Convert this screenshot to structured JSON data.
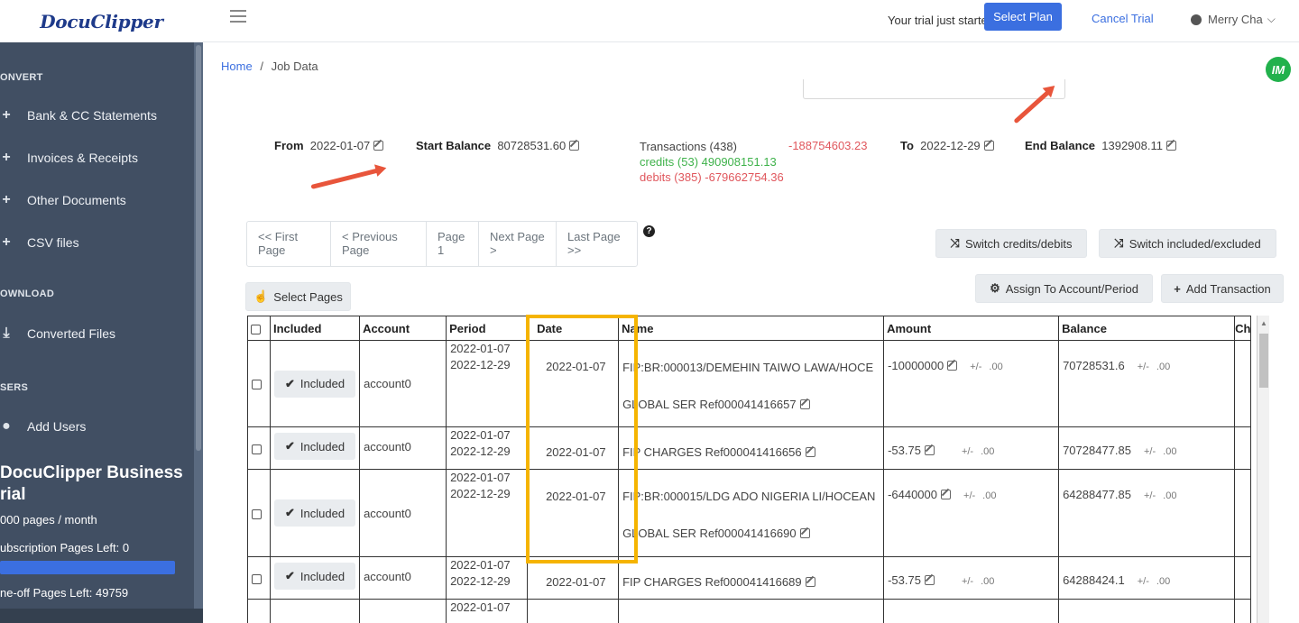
{
  "app": {
    "brand": "DocuClipper"
  },
  "sidebar": {
    "sections": [
      {
        "title": "ONVERT",
        "items": [
          "Bank & CC Statements",
          "Invoices & Receipts",
          "Other Documents",
          "CSV files"
        ]
      },
      {
        "title": "OWNLOAD",
        "items": [
          "Converted Files"
        ]
      },
      {
        "title": "SERS",
        "items": [
          "Add Users"
        ]
      }
    ],
    "plan": {
      "title_line1": "DocuClipper Business",
      "title_line2": "rial",
      "pages_per_month": "000 pages / month",
      "subscription_left": "ubscription Pages Left: 0",
      "oneoff_left": "ne-off Pages Left: 49759",
      "progress_fraction": 1.0
    }
  },
  "topbar": {
    "trial_text": "Your trial just started",
    "select_plan": "Select Plan",
    "cancel_trial": "Cancel Trial",
    "user_name": "Merry Cha"
  },
  "breadcrumb": {
    "home": "Home",
    "separator": "/",
    "current": "Job Data"
  },
  "badge": "IM",
  "summary": {
    "from_label": "From",
    "from_value": "2022-01-07",
    "start_balance_label": "Start Balance",
    "start_balance_value": "80728531.60",
    "transactions": "Transactions (438)",
    "net": "-188754603.23",
    "credits": "credits (53) 490908151.13",
    "debits": "debits (385) -679662754.36",
    "to_label": "To",
    "to_value": "2022-12-29",
    "end_balance_label": "End Balance",
    "end_balance_value": "1392908.11"
  },
  "pager": {
    "first": [
      "<< First",
      "Page"
    ],
    "previous": [
      "< Previous",
      "Page"
    ],
    "page": [
      "Page",
      "1"
    ],
    "next": [
      "Next Page",
      ">"
    ],
    "last": [
      "Last Page",
      ">>"
    ]
  },
  "buttons": {
    "switch_credits": "Switch credits/debits",
    "switch_included": "Switch included/excluded",
    "assign": "Assign To Account/Period",
    "add_transaction": "Add Transaction",
    "select_pages": "Select Pages"
  },
  "table": {
    "headers": [
      "",
      "Included",
      "Account",
      "Period",
      "Date",
      "Name",
      "Amount",
      "Balance",
      "Ch"
    ],
    "rows": [
      {
        "included": "Included",
        "account": "account0",
        "period_start": "2022-01-07",
        "period_end": "2022-12-29",
        "date": "2022-01-07",
        "name_line1": "FIP:BR:000013/DEMEHIN TAIWO LAWA/HOCE",
        "name_line2": "GLOBAL SER Ref000041416657",
        "amount": "-10000000",
        "amount_pm": "+/-",
        "amount_dec": ".00",
        "balance": "70728531.6",
        "balance_pm": "+/-",
        "balance_dec": ".00"
      },
      {
        "included": "Included",
        "account": "account0",
        "period_start": "2022-01-07",
        "period_end": "2022-12-29",
        "date": "2022-01-07",
        "name_line1": "FIP CHARGES Ref000041416656",
        "name_line2": "",
        "amount": "-53.75",
        "amount_pm": "+/-",
        "amount_dec": ".00",
        "balance": "70728477.85",
        "balance_pm": "+/-",
        "balance_dec": ".00"
      },
      {
        "included": "Included",
        "account": "account0",
        "period_start": "2022-01-07",
        "period_end": "2022-12-29",
        "date": "2022-01-07",
        "name_line1": "FIP:BR:000015/LDG ADO NIGERIA LI/HOCEAN",
        "name_line2": "GLOBAL SER Ref000041416690",
        "amount": "-6440000",
        "amount_pm": "+/-",
        "amount_dec": ".00",
        "balance": "64288477.85",
        "balance_pm": "+/-",
        "balance_dec": ".00"
      },
      {
        "included": "Included",
        "account": "account0",
        "period_start": "2022-01-07",
        "period_end": "2022-12-29",
        "date": "2022-01-07",
        "name_line1": "FIP CHARGES Ref000041416689",
        "name_line2": "",
        "amount": "-53.75",
        "amount_pm": "+/-",
        "amount_dec": ".00",
        "balance": "64288424.1",
        "balance_pm": "+/-",
        "balance_dec": ".00"
      },
      {
        "included": "",
        "account": "",
        "period_start": "2022-01-07",
        "period_end": "",
        "date": "",
        "name_line1": "",
        "name_line2": "",
        "amount": "",
        "amount_pm": "",
        "amount_dec": "",
        "balance": "",
        "balance_pm": "",
        "balance_dec": ""
      }
    ]
  },
  "colors": {
    "sidebar_bg": "#414f63",
    "primary": "#3b6fe0",
    "credit": "#3fb24b",
    "debit": "#e0575d",
    "highlight": "#f5b400",
    "arrow": "#e8553b"
  }
}
